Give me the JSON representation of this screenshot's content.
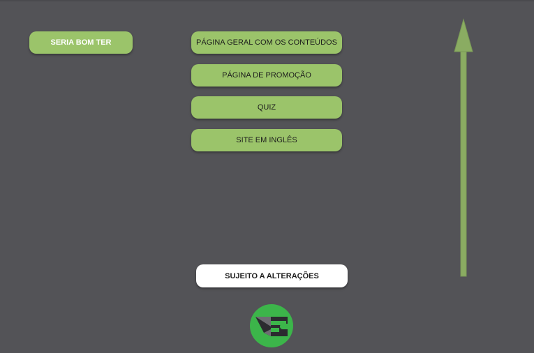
{
  "left_button": {
    "label": "SERIA BOM TER"
  },
  "page_list": [
    {
      "label": "PÁGINA GERAL COM OS CONTEÚDOS"
    },
    {
      "label": "PÁGINA DE PROMOÇÃO"
    },
    {
      "label": "QUIZ"
    },
    {
      "label": "SITE EM INGLÊS"
    }
  ],
  "notice": {
    "label": "SUJEITO A ALTERAÇÕES"
  },
  "colors": {
    "background": "#535357",
    "button_green": "#9bc46a",
    "arrow_green": "#8aac62",
    "logo_green": "#3cb54a",
    "notice_bg": "#ffffff"
  },
  "icons": {
    "arrow": "up-arrow-icon",
    "logo": "brand-logo-icon"
  }
}
